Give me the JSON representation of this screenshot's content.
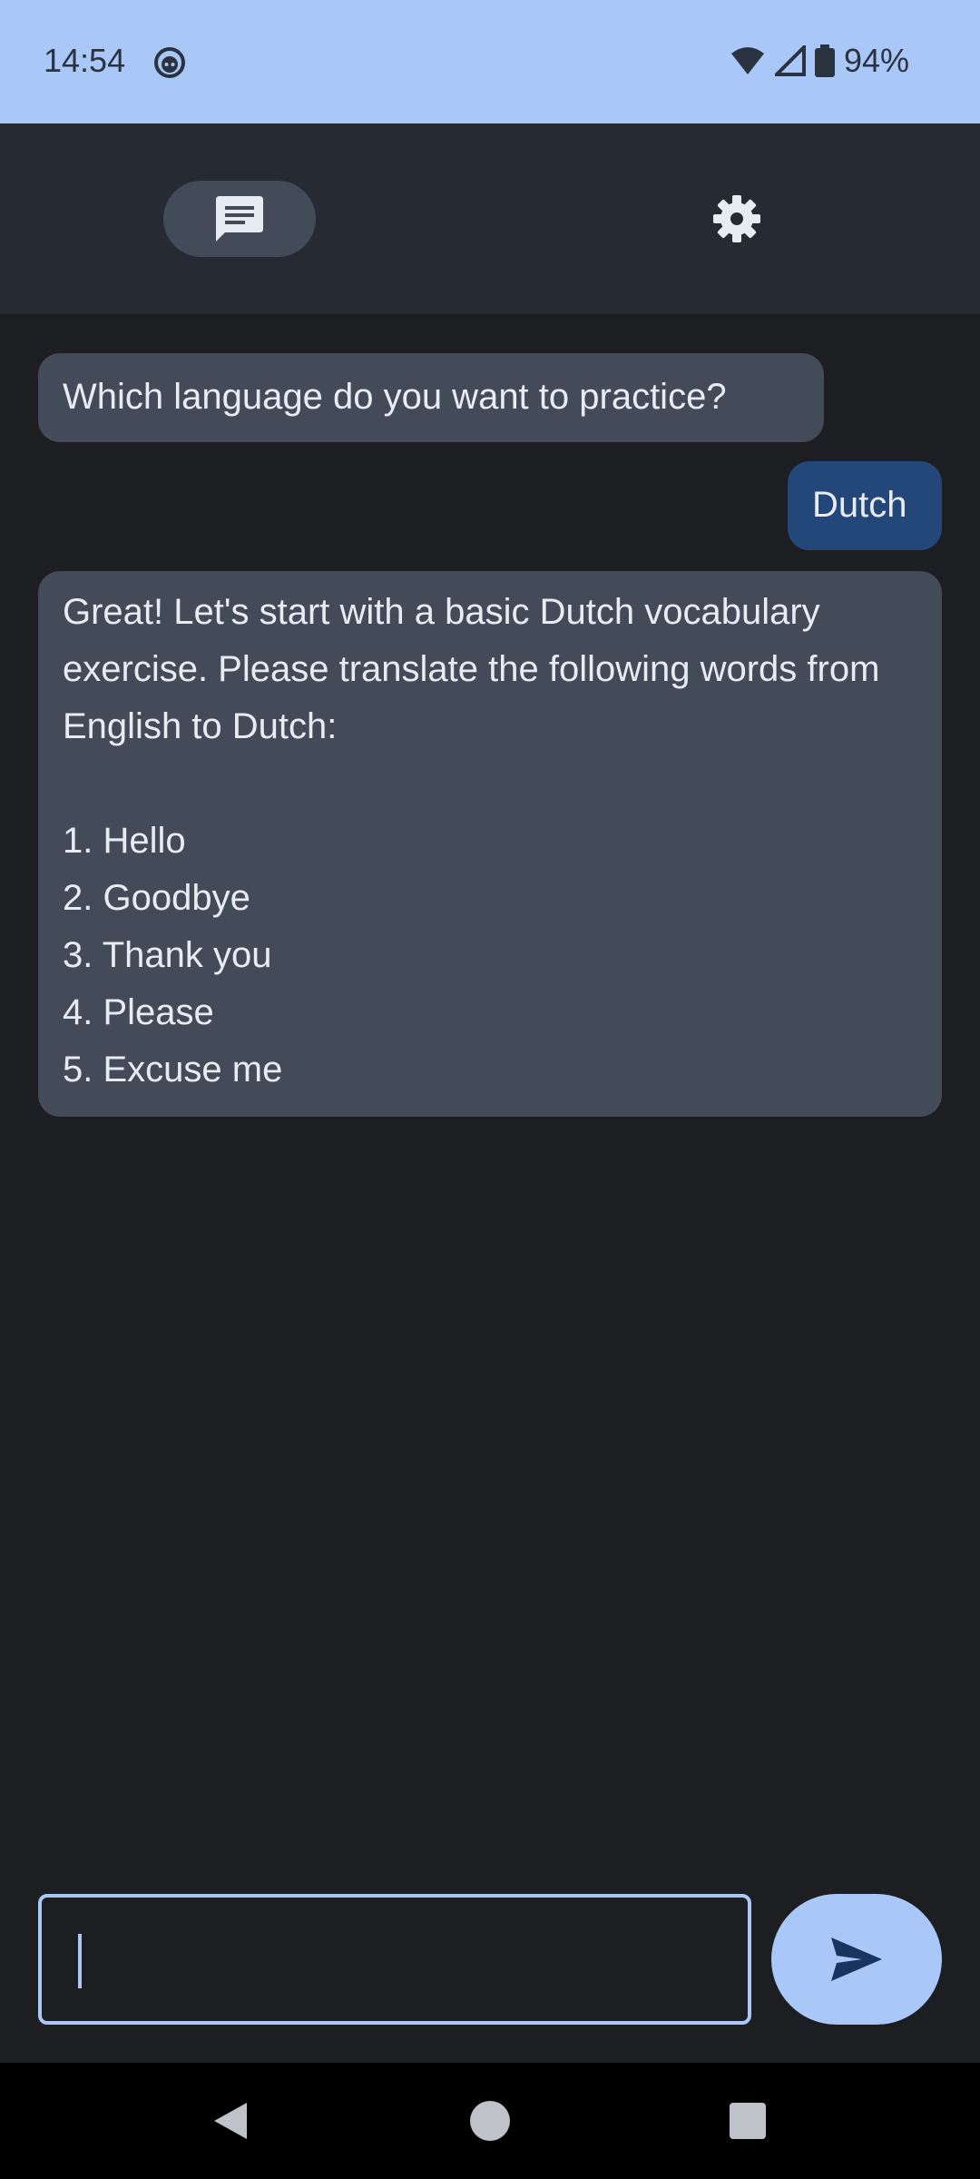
{
  "status_bar": {
    "time": "14:54",
    "battery": "94%",
    "icons": [
      "face-icon",
      "wifi-icon",
      "signal-icon",
      "battery-icon"
    ]
  },
  "top_bar": {
    "chat_tab_icon": "chat-icon",
    "settings_icon": "gear-icon"
  },
  "chat": {
    "messages": [
      {
        "role": "bot",
        "text": "Which language do you want to practice?"
      },
      {
        "role": "user",
        "text": "Dutch"
      },
      {
        "role": "bot",
        "text": "Great! Let's start with a basic Dutch vocabulary exercise. Please translate the following words from English to Dutch:\n\n1. Hello\n2. Goodbye\n3. Thank you\n4. Please\n5. Excuse me"
      }
    ]
  },
  "composer": {
    "value": "",
    "placeholder": "",
    "send_icon": "send-icon"
  },
  "nav": {
    "back_icon": "back-icon",
    "home_icon": "home-icon",
    "recents_icon": "recents-icon"
  },
  "colors": {
    "accent": "#a9c8f7",
    "bot_bubble": "#434b58",
    "user_bubble": "#244779",
    "background": "#1d1e21",
    "top_bar": "#262b33"
  }
}
